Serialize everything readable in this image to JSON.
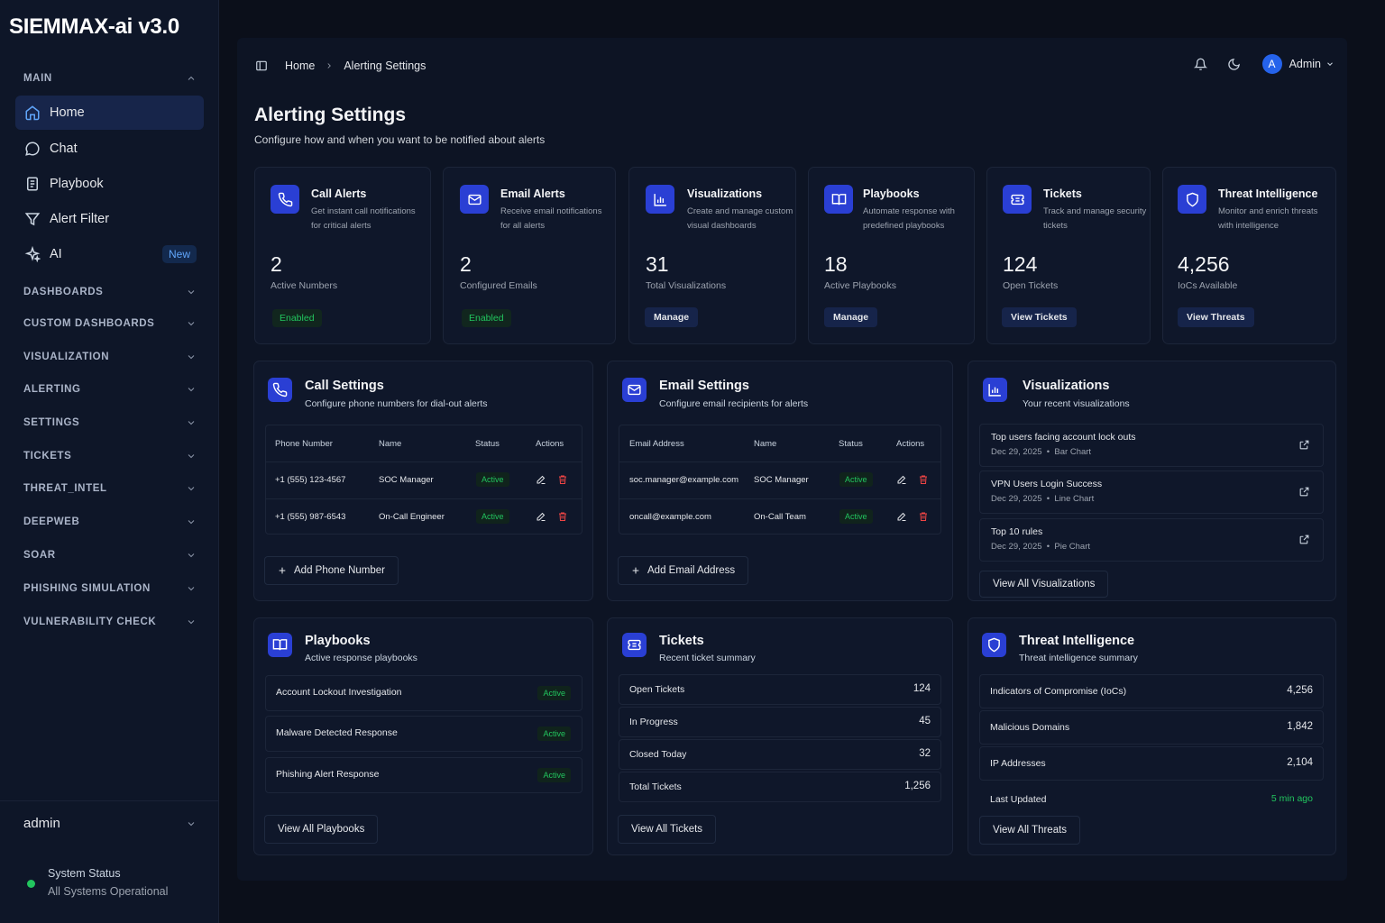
{
  "app": {
    "title": "SIEMMAX-ai v3.0"
  },
  "sidebar": {
    "main_label": "MAIN",
    "items": [
      {
        "label": "Home"
      },
      {
        "label": "Chat"
      },
      {
        "label": "Playbook"
      },
      {
        "label": "Alert Filter"
      },
      {
        "label": "AI",
        "badge": "New"
      }
    ],
    "sections": [
      "DASHBOARDS",
      "CUSTOM DASHBOARDS",
      "VISUALIZATION",
      "ALERTING",
      "SETTINGS",
      "TICKETS",
      "THREAT_INTEL",
      "DEEPWEB",
      "SOAR",
      "PHISHING SIMULATION",
      "VULNERABILITY CHECK"
    ],
    "user": "admin",
    "status_title": "System Status",
    "status_text": "All Systems Operational",
    "status_color": "#22c55e"
  },
  "header": {
    "breadcrumb": [
      "Home",
      "Alerting Settings"
    ],
    "avatar_initial": "A",
    "user_name": "Admin"
  },
  "page": {
    "title": "Alerting Settings",
    "subtitle": "Configure how and when you want to be notified about alerts"
  },
  "stats": [
    {
      "title": "Call Alerts",
      "desc": "Get instant call notifications for critical alerts",
      "value": "2",
      "label": "Active Numbers",
      "action": "Enabled",
      "icon": "phone-icon"
    },
    {
      "title": "Email Alerts",
      "desc": "Receive email notifications for all alerts",
      "value": "2",
      "label": "Configured Emails",
      "action": "Enabled",
      "icon": "mail-icon"
    },
    {
      "title": "Visualizations",
      "desc": "Create and manage custom visual dashboards",
      "value": "31",
      "label": "Total Visualizations",
      "action": "Manage",
      "icon": "chart-icon"
    },
    {
      "title": "Playbooks",
      "desc": "Automate response with predefined playbooks",
      "value": "18",
      "label": "Active Playbooks",
      "action": "Manage",
      "icon": "book-icon"
    },
    {
      "title": "Tickets",
      "desc": "Track and manage security tickets",
      "value": "124",
      "label": "Open Tickets",
      "action": "View Tickets",
      "icon": "ticket-icon"
    },
    {
      "title": "Threat Intelligence",
      "desc": "Monitor and enrich threats with intelligence",
      "value": "4,256",
      "label": "IoCs Available",
      "action": "View Threats",
      "icon": "shield-icon"
    }
  ],
  "call_settings": {
    "title": "Call Settings",
    "subtitle": "Configure phone numbers for dial-out alerts",
    "columns": [
      "Phone Number",
      "Name",
      "Status",
      "Actions"
    ],
    "rows": [
      {
        "phone": "+1 (555) 123-4567",
        "name": "SOC Manager",
        "status": "Active"
      },
      {
        "phone": "+1 (555) 987-6543",
        "name": "On-Call Engineer",
        "status": "Active"
      }
    ],
    "add_label": "Add Phone Number"
  },
  "email_settings": {
    "title": "Email Settings",
    "subtitle": "Configure email recipients for alerts",
    "columns": [
      "Email Address",
      "Name",
      "Status",
      "Actions"
    ],
    "rows": [
      {
        "email": "soc.manager@example.com",
        "name": "SOC Manager",
        "status": "Active"
      },
      {
        "email": "oncall@example.com",
        "name": "On-Call Team",
        "status": "Active"
      }
    ],
    "add_label": "Add Email Address"
  },
  "visualizations": {
    "title": "Visualizations",
    "subtitle": "Your recent visualizations",
    "items": [
      {
        "name": "Top users facing account lock outs",
        "date": "Dec 29, 2025",
        "type": "Bar Chart"
      },
      {
        "name": "VPN Users Login Success",
        "date": "Dec 29, 2025",
        "type": "Line Chart"
      },
      {
        "name": "Top 10 rules",
        "date": "Dec 29, 2025",
        "type": "Pie Chart"
      }
    ],
    "separator": "•",
    "view_all": "View All Visualizations"
  },
  "playbooks": {
    "title": "Playbooks",
    "subtitle": "Active response playbooks",
    "items": [
      {
        "name": "Account Lockout Investigation",
        "status": "Active"
      },
      {
        "name": "Malware Detected Response",
        "status": "Active"
      },
      {
        "name": "Phishing Alert Response",
        "status": "Active"
      }
    ],
    "view_all": "View All Playbooks"
  },
  "tickets": {
    "title": "Tickets",
    "subtitle": "Recent ticket summary",
    "items": [
      {
        "label": "Open Tickets",
        "value": "124"
      },
      {
        "label": "In Progress",
        "value": "45"
      },
      {
        "label": "Closed Today",
        "value": "32"
      },
      {
        "label": "Total Tickets",
        "value": "1,256"
      }
    ],
    "view_all": "View All Tickets"
  },
  "threat_intel": {
    "title": "Threat Intelligence",
    "subtitle": "Threat intelligence summary",
    "items": [
      {
        "label": "Indicators of Compromise (IoCs)",
        "value": "4,256"
      },
      {
        "label": "Malicious Domains",
        "value": "1,842"
      },
      {
        "label": "IP Addresses",
        "value": "2,104"
      },
      {
        "label": "Last Updated",
        "value": "5 min ago",
        "accent": "#22c55e"
      }
    ],
    "view_all": "View All Threats"
  },
  "colors": {
    "accent": "#2a3fd4",
    "success": "#22c55e",
    "danger": "#ef4444",
    "background": "#0b0f1a"
  }
}
